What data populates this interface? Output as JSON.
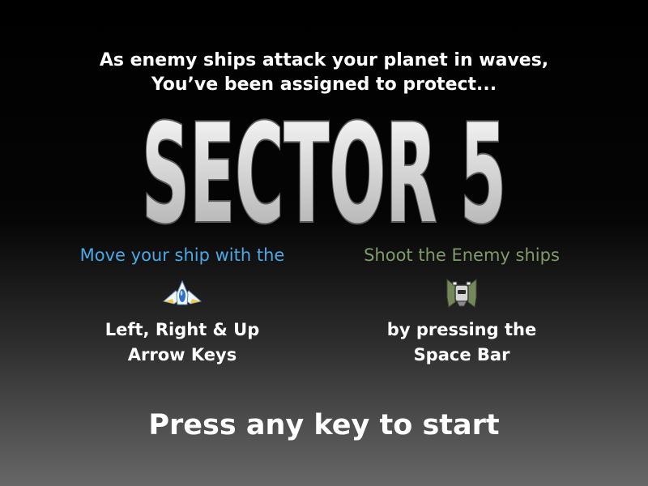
{
  "intro": {
    "line1": "As enemy ships attack your planet in waves,",
    "line2": "You’ve been assigned to protect..."
  },
  "title": {
    "text": "SECTOR 5",
    "fill_top": "#ffffff",
    "fill_bottom": "#a9a9a9",
    "outline": "#5c5c5c"
  },
  "controls": {
    "move": {
      "caption": "Move your ship with the",
      "caption_color": "#4aa8e6",
      "icon": "player-ship-icon",
      "line1": "Left, Right & Up",
      "line2": "Arrow Keys"
    },
    "shoot": {
      "caption": "Shoot the Enemy ships",
      "caption_color": "#7f9a6a",
      "icon": "enemy-ship-icon",
      "line1": "by pressing the",
      "line2": "Space Bar"
    }
  },
  "start_prompt": "Press any key to start"
}
